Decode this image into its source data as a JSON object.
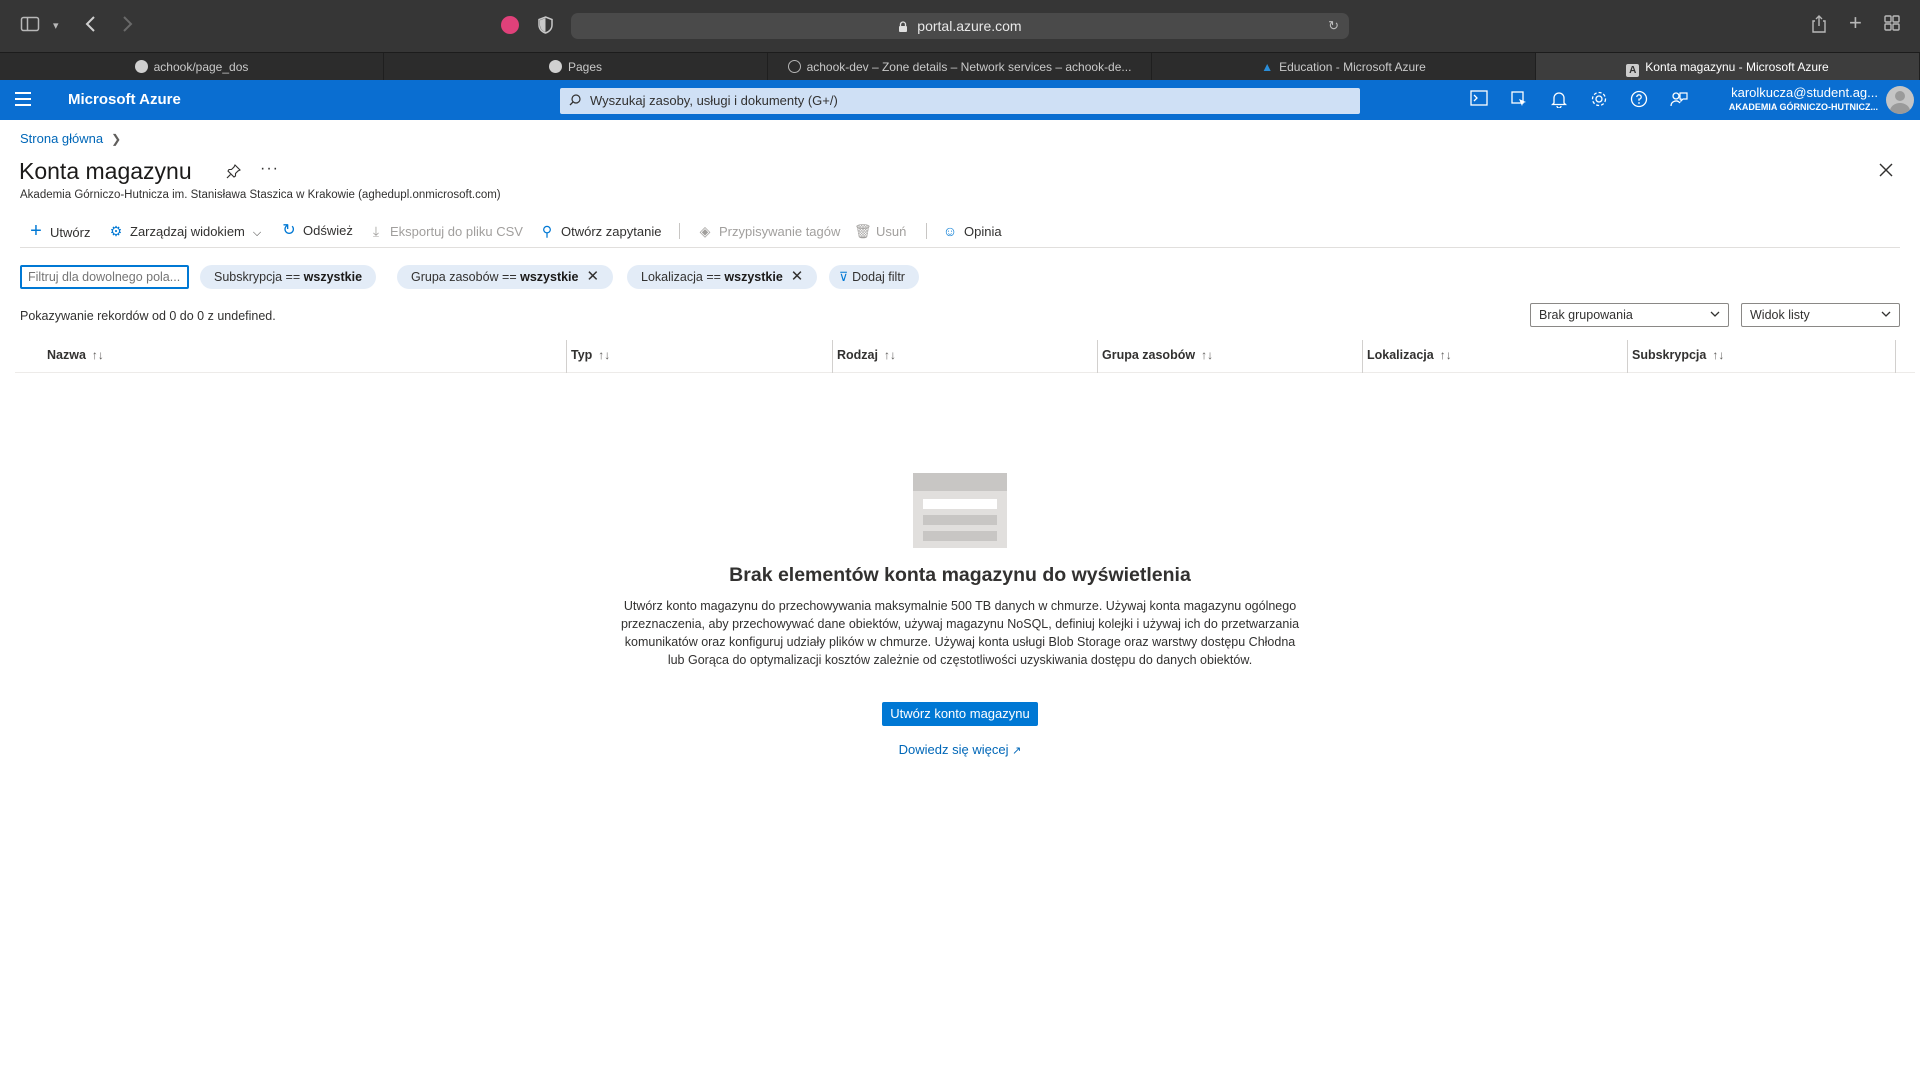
{
  "browser": {
    "url": "portal.azure.com",
    "ext_badge": "ABP",
    "tabs": [
      {
        "label": "achook/page_dos",
        "icon": "github-icon",
        "active": false
      },
      {
        "label": "Pages",
        "icon": "github-icon",
        "active": false
      },
      {
        "label": "achook-dev – Zone details – Network services – achook-de...",
        "icon": "globe-icon",
        "active": false
      },
      {
        "label": "Education - Microsoft Azure",
        "icon": "azure-icon",
        "active": false
      },
      {
        "label": "Konta magazynu - Microsoft Azure",
        "icon": "azure-a-icon",
        "active": true
      }
    ]
  },
  "azure": {
    "brand": "Microsoft Azure",
    "search_placeholder": "Wyszukaj zasoby, usługi i dokumenty (G+/)",
    "user_name": "karolkucza@student.ag...",
    "user_org": "AKADEMIA GÓRNICZO-HUTNICZ...",
    "accent": "#0078d4"
  },
  "page": {
    "breadcrumb_home": "Strona główna",
    "title": "Konta magazynu",
    "subtitle": "Akademia Górniczo-Hutnicza im. Stanisława Staszica w Krakowie (aghedupl.onmicrosoft.com)"
  },
  "commands": {
    "create": "Utwórz",
    "manage_view": "Zarządzaj widokiem",
    "refresh": "Odśwież",
    "export_csv": "Eksportuj do pliku CSV",
    "open_query": "Otwórz zapytanie",
    "assign_tags": "Przypisywanie tagów",
    "delete": "Usuń",
    "feedback": "Opinia"
  },
  "filters": {
    "input_placeholder": "Filtruj dla dowolnego pola...",
    "subscription_label": "Subskrypcja ==",
    "subscription_value": "wszystkie",
    "resource_group_label": "Grupa zasobów ==",
    "resource_group_value": "wszystkie",
    "location_label": "Lokalizacja ==",
    "location_value": "wszystkie",
    "add_filter": "Dodaj filtr"
  },
  "list": {
    "records_text": "Pokazywanie rekordów od 0 do 0 z undefined.",
    "grouping": "Brak grupowania",
    "view": "Widok listy",
    "columns": [
      "Nazwa",
      "Typ",
      "Rodzaj",
      "Grupa zasobów",
      "Lokalizacja",
      "Subskrypcja"
    ]
  },
  "empty_state": {
    "title": "Brak elementów konta magazynu do wyświetlenia",
    "description": "Utwórz konto magazynu do przechowywania maksymalnie 500 TB danych w chmurze. Używaj konta magazynu ogólnego przeznaczenia, aby przechowywać dane obiektów, używaj magazynu NoSQL, definiuj kolejki i używaj ich do przetwarzania komunikatów oraz konfiguruj udziały plików w chmurze. Używaj konta usługi Blob Storage oraz warstwy dostępu Chłodna lub Gorąca do optymalizacji kosztów zależnie od częstotliwości uzyskiwania dostępu do danych obiektów.",
    "create_button": "Utwórz konto magazynu",
    "learn_more": "Dowiedz się więcej"
  }
}
